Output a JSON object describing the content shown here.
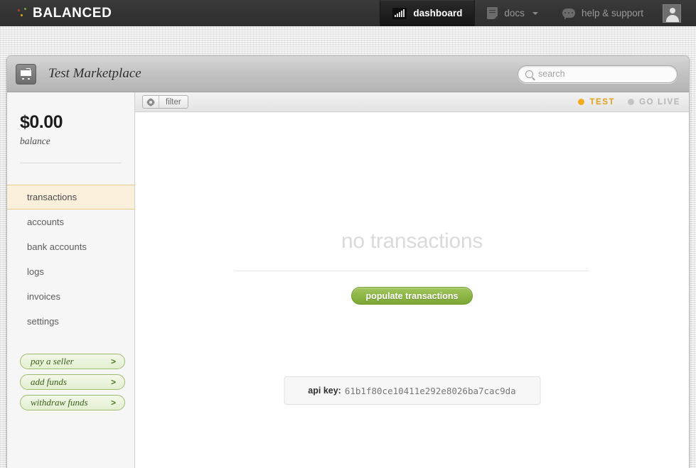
{
  "topnav": {
    "brand": "BALANCED",
    "items": [
      {
        "label": "dashboard",
        "icon": "dashboard-chart-icon",
        "active": true,
        "caret": false
      },
      {
        "label": "docs",
        "icon": "document-icon",
        "active": false,
        "caret": true
      },
      {
        "label": "help & support",
        "icon": "speech-bubble-icon",
        "active": false,
        "caret": false
      }
    ],
    "avatar_icon": "user-avatar-icon"
  },
  "panel": {
    "marketplace_title": "Test Marketplace",
    "cart_icon": "shopping-cart-icon",
    "search": {
      "placeholder": "search",
      "value": "",
      "icon": "search-icon"
    }
  },
  "sidebar": {
    "balance_amount": "$0.00",
    "balance_label": "balance",
    "nav_items": [
      {
        "label": "transactions",
        "active": true
      },
      {
        "label": "accounts",
        "active": false
      },
      {
        "label": "bank accounts",
        "active": false
      },
      {
        "label": "logs",
        "active": false
      },
      {
        "label": "invoices",
        "active": false
      },
      {
        "label": "settings",
        "active": false
      }
    ],
    "action_buttons": [
      {
        "label": "pay a seller",
        "chevron": ">"
      },
      {
        "label": "add funds",
        "chevron": ">"
      },
      {
        "label": "withdraw funds",
        "chevron": ">"
      }
    ]
  },
  "filter_bar": {
    "filter_label": "filter",
    "gear_icon": "gear-icon",
    "modes": [
      {
        "label": "TEST",
        "active": true
      },
      {
        "label": "GO LIVE",
        "active": false
      }
    ]
  },
  "main": {
    "empty_title": "no transactions",
    "populate_button": "populate transactions",
    "api_key_label": "api key:",
    "api_key_value": "61b1f80ce10411e292e8026ba7cac9da"
  },
  "colors": {
    "accent_green": "#8bb544",
    "accent_amber": "#f0ac1d",
    "nav_dark": "#333333",
    "highlight_cream": "#fbf0dc"
  }
}
